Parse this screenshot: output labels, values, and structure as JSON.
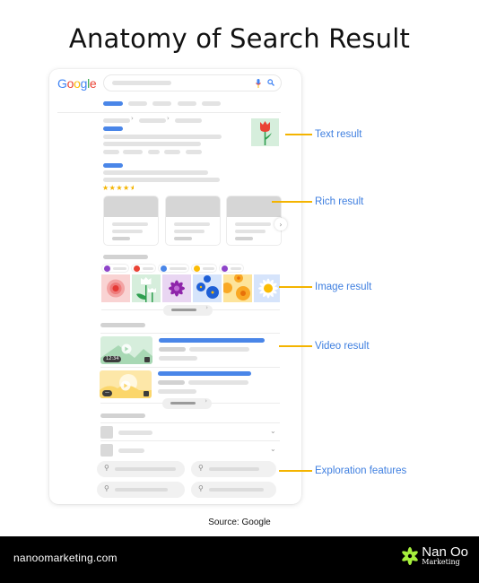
{
  "title": "Anatomy of Search Result",
  "search_page": {
    "logo": {
      "letters": [
        "G",
        "o",
        "o",
        "g",
        "l",
        "e"
      ],
      "colors": [
        "#4285f4",
        "#ea4335",
        "#fbbc05",
        "#4285f4",
        "#34a853",
        "#ea4335"
      ]
    },
    "search_icons": [
      "mic-icon",
      "search-icon"
    ],
    "rich_result": {
      "rating_stars": 4.5,
      "max_stars": 5
    },
    "video_results": [
      {
        "duration": "12:34"
      },
      {
        "duration": "—"
      }
    ]
  },
  "callouts": [
    {
      "label": "Text result"
    },
    {
      "label": "Rich result"
    },
    {
      "label": "Image result"
    },
    {
      "label": "Video result"
    },
    {
      "label": "Exploration features"
    }
  ],
  "colors": {
    "accent_line": "#f4b400",
    "label_blue": "#3f7fe0",
    "link_blue": "#4a86e8"
  },
  "source": "Source: Google",
  "footer": {
    "website": "nanoomarketing.com",
    "brand_line1": "Nan Oo",
    "brand_line2": "Marketing",
    "brand_color": "#a6f03c"
  }
}
